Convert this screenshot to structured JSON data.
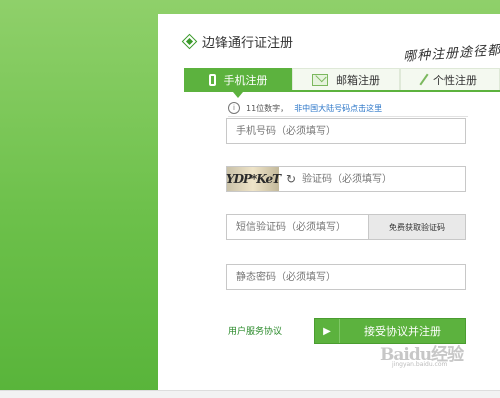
{
  "header": {
    "brand_title": "边锋通行证注册",
    "handwriting": "哪种注册途径都可"
  },
  "tabs": [
    {
      "label": "手机注册",
      "icon": "mobile-phone-icon",
      "active": true
    },
    {
      "label": "邮箱注册",
      "icon": "envelope-icon",
      "active": false
    },
    {
      "label": "个性注册",
      "icon": "pen-icon",
      "active": false
    }
  ],
  "hint": {
    "text": "11位数字，",
    "link": "非中国大陆号码点击这里"
  },
  "form": {
    "phone_placeholder": "手机号码（必须填写）",
    "captcha_image_text": "YDP*KeT",
    "captcha_placeholder": "验证码（必须填写）",
    "sms_placeholder": "短信验证码（必须填写）",
    "sms_button": "免费获取验证码",
    "password_placeholder": "静态密码（必须填写）"
  },
  "footer": {
    "agreement_link": "用户服务协议",
    "submit_label": "接受协议并注册"
  },
  "watermark": {
    "main": "Baidu经验",
    "sub": "jingyan.baidu.com"
  },
  "colors": {
    "accent": "#5cb23e",
    "link": "#2a75c8"
  }
}
